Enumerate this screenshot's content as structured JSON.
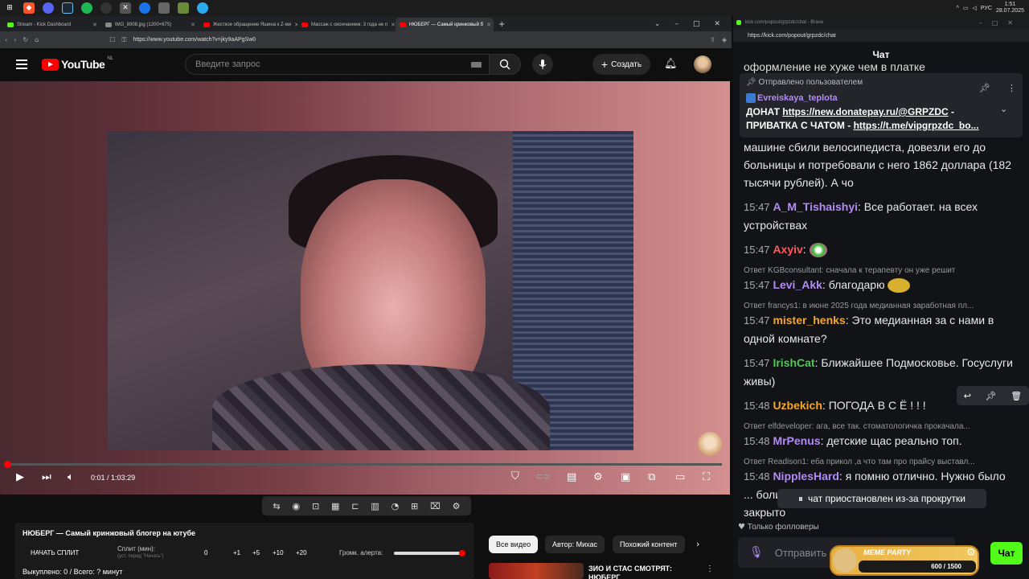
{
  "taskbar": {
    "lang": "РУС",
    "time": "1:51",
    "date": "28.07.2025"
  },
  "browser": {
    "tabs": [
      {
        "label": "Stream - Kick Dashboard",
        "color": "#53fc18"
      },
      {
        "label": "IMG_8908.jpg (1200×675)",
        "color": "#888888"
      },
      {
        "label": "Жесткое обращение Яшина к Z-ми",
        "color": "#ff0000"
      },
      {
        "label": "Массаж с окончанием: 3 года не п",
        "color": "#ff0000"
      },
      {
        "label": "НЮБЕРГ — Самый кринжовый б",
        "color": "#ff0000"
      }
    ],
    "url": "https://www.youtube.com/watch?v=jky9aAPgSw0"
  },
  "youtube": {
    "logo": "YouTube",
    "region": "NL",
    "search_placeholder": "Введите запрос",
    "create_label": "Создать",
    "time_current": "0:01",
    "time_total": "1:03:29",
    "progress": 0.001
  },
  "split": {
    "title": "НЮБЕРГ — Самый кринжовый блогер на ютубе",
    "start": "НАЧАТЬ СПЛИТ",
    "split_label": "Сплит (мин):",
    "split_hint": "(уст. перед \"Начать\")",
    "values": [
      "0",
      "+1",
      "+5",
      "+10",
      "+20"
    ],
    "volume_label": "Громк. алерта:",
    "volume": 0.98,
    "bought": "Выкуплено: 0 / Всего: ? минут"
  },
  "chips": [
    "Все видео",
    "Автор: Михас",
    "Похожий контент"
  ],
  "recommend": {
    "title": "ЗИО И СТАС СМОТРЯТ: НЮБЕРГ"
  },
  "kick": {
    "window_title": "kick.com/popout/grpzdc/chat - Brave",
    "url": "https://kick.com/popout/grpzdc/chat",
    "header": "Чат",
    "partial_top": "оформление не хуже чем в платке",
    "pinned": {
      "header": "Отправлено пользователем",
      "user": "Evreiskaya_teplota",
      "line1_prefix": "ДОНАТ ",
      "line1_link": "https://new.donatepay.ru/@GRPZDC",
      "line1_suffix": " -",
      "line2_prefix": "ПРИВАТКА С ЧАТОМ - ",
      "line2_link": "https://t.me/vipgrpzdc_bo..."
    },
    "prev_text": "машине сбили велосипедиста, довезли его до больницы и потребовали с него 1862 доллара (182 тысячи рублей). А чо",
    "messages": [
      {
        "time": "15:47",
        "user": "A_M_Tishaishyi",
        "color": "#b38bf5",
        "text": "Все работает. на всех устройствах"
      },
      {
        "time": "15:47",
        "user": "Axyiv",
        "color": "#ff5a5a",
        "text": ""
      },
      {
        "time": "15:47",
        "user": "Levi_Akk",
        "color": "#b38bf5",
        "text": "благодарю",
        "reply": "Ответ KGBconsultant: сначала к терапевту он уже решит"
      },
      {
        "time": "15:47",
        "user": "mister_henks",
        "color": "#f5a623",
        "text": "Это медианная за с нами в одной комнате?",
        "reply": "Ответ francys1: в июне 2025 года медианная заработная пл..."
      },
      {
        "time": "15:47",
        "user": "IrishCat",
        "color": "#53c653",
        "text": "Ближайшее Подмосковье. Госуслуги живы)"
      },
      {
        "time": "15:48",
        "user": "Uzbekich",
        "color": "#f5a623",
        "text": "ПОГОДА В С Ё ! ! !"
      },
      {
        "time": "15:48",
        "user": "MrPenus",
        "color": "#b38bf5",
        "text": "детские щас реально топ.",
        "reply": "Ответ elfdeveloper: ага, все так. стоматологичка прокачала..."
      },
      {
        "time": "15:48",
        "user": "NipplesHard",
        "color": "#b38bf5",
        "text": "я помню отлично. Нужно было ... боли, и так терпел воскресенье, так как всё закрыто",
        "reply": "Ответ Readison1: еба прикол ,а что там про прайсу выставл..."
      }
    ],
    "paused": "чат приостановлен из-за прокрутки",
    "followers_only": "Только фолловеры",
    "input_placeholder": "Отправить сообщение",
    "meme_party": "MEME PARTY",
    "meme_progress": "600 / 1500",
    "chat_button": "Чат"
  }
}
